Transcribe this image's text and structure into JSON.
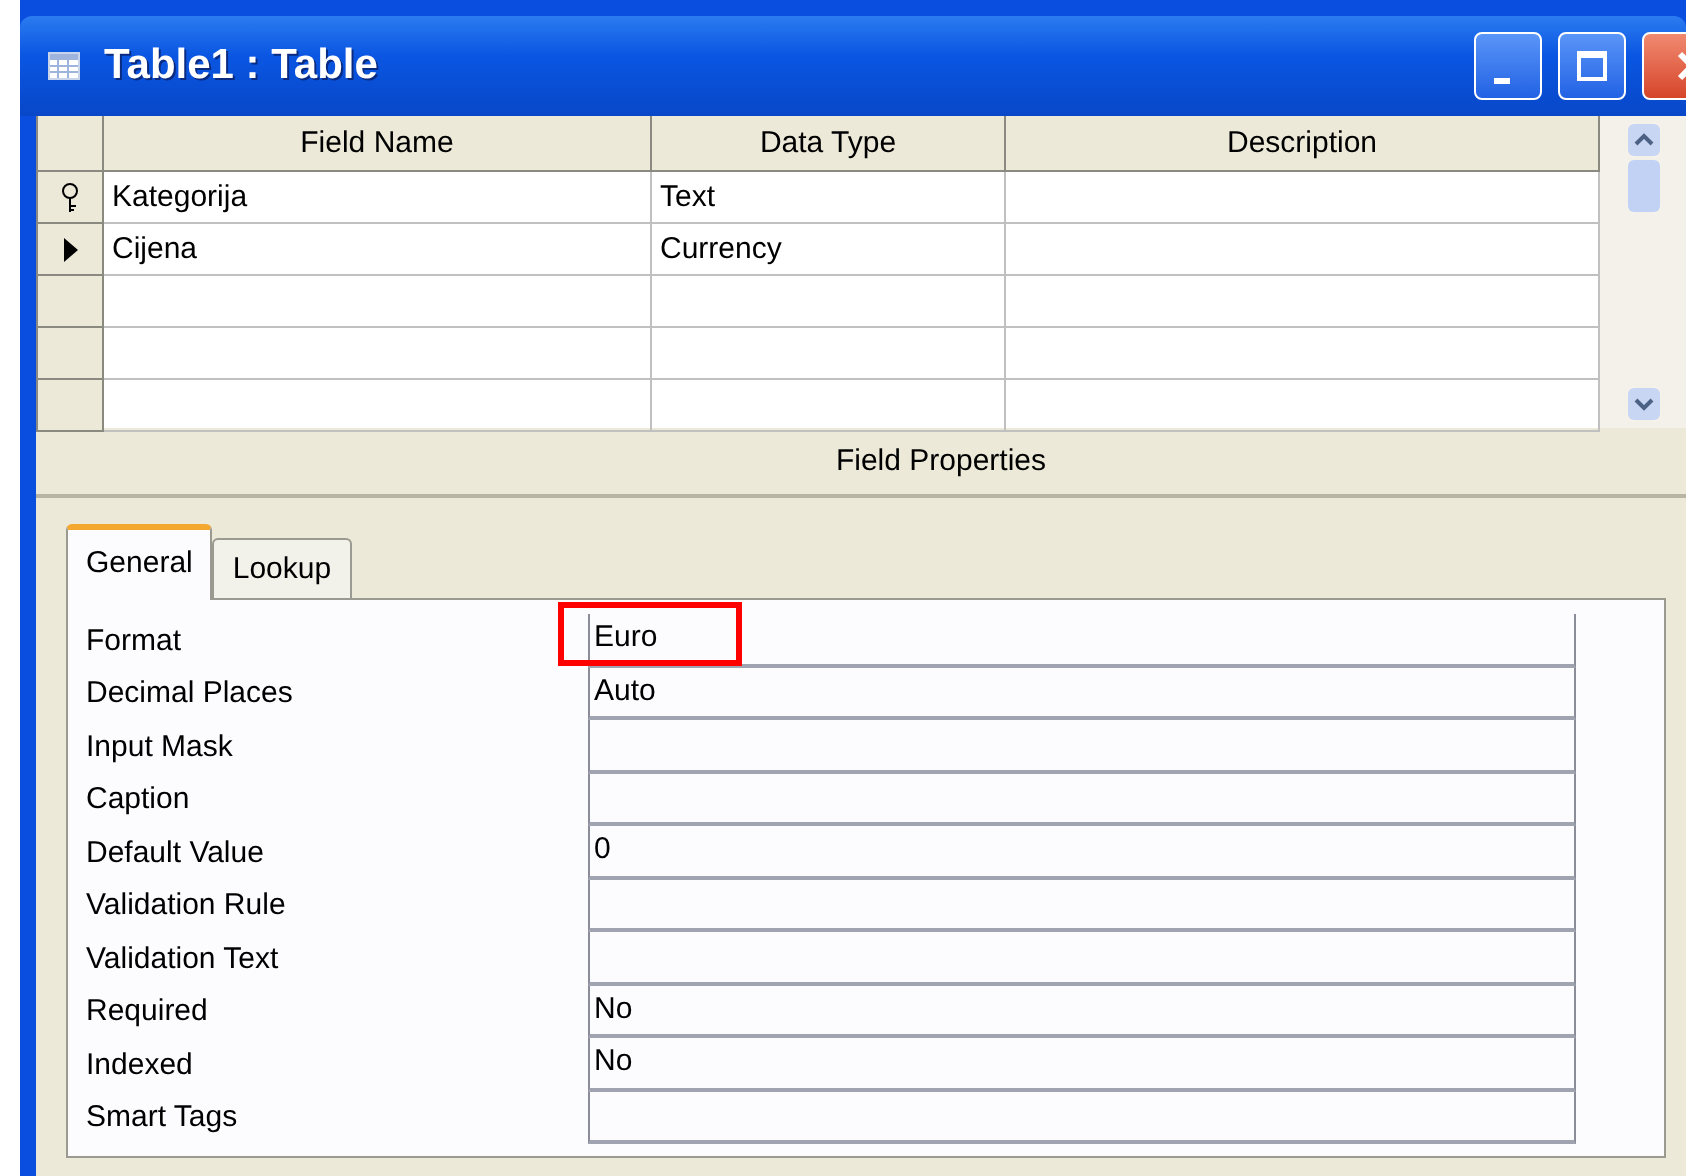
{
  "window": {
    "title": "Table1 : Table"
  },
  "design_grid": {
    "columns": [
      "Field Name",
      "Data Type",
      "Description"
    ],
    "rows": [
      {
        "field_name": "Kategorija",
        "data_type": "Text",
        "description": "",
        "primary_key": true,
        "current": false
      },
      {
        "field_name": "Cijena",
        "data_type": "Currency",
        "description": "",
        "primary_key": false,
        "current": true
      },
      {
        "field_name": "",
        "data_type": "",
        "description": "",
        "primary_key": false,
        "current": false
      },
      {
        "field_name": "",
        "data_type": "",
        "description": "",
        "primary_key": false,
        "current": false
      },
      {
        "field_name": "",
        "data_type": "",
        "description": "",
        "primary_key": false,
        "current": false
      }
    ]
  },
  "field_properties": {
    "title": "Field Properties",
    "tabs": [
      {
        "label": "General",
        "selected": true
      },
      {
        "label": "Lookup",
        "selected": false
      }
    ],
    "properties": [
      {
        "label": "Format",
        "value": "Euro",
        "highlighted": true
      },
      {
        "label": "Decimal Places",
        "value": "Auto",
        "highlighted": false
      },
      {
        "label": "Input Mask",
        "highlighted": false
      },
      {
        "label": "Caption",
        "highlighted": false
      },
      {
        "label": "Default Value",
        "value": "0",
        "highlighted": false
      },
      {
        "label": "Validation Rule",
        "highlighted": false
      },
      {
        "label": "Validation Text",
        "highlighted": false
      },
      {
        "label": "Required",
        "value": "No",
        "highlighted": false
      },
      {
        "label": "Indexed",
        "value": "No",
        "highlighted": false
      },
      {
        "label": "Smart Tags",
        "highlighted": false
      }
    ]
  }
}
